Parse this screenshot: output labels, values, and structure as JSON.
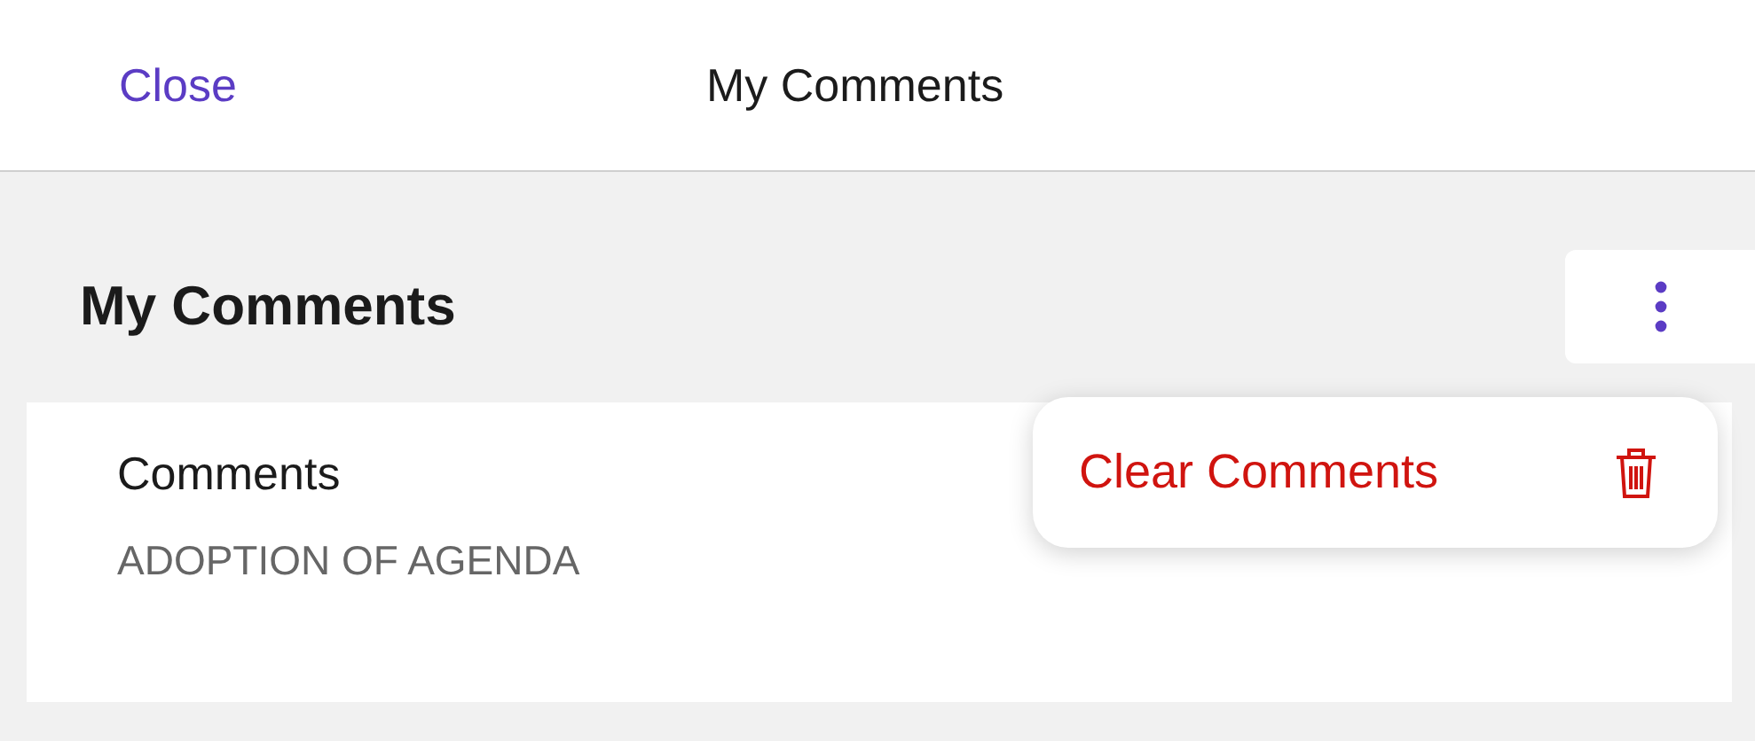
{
  "header": {
    "close_label": "Close",
    "title": "My Comments"
  },
  "section": {
    "heading": "My Comments",
    "menu_expanded": true
  },
  "card": {
    "title": "Comments",
    "subtitle": "ADOPTION OF AGENDA"
  },
  "menu": {
    "items": [
      {
        "label": "Clear Comments",
        "kind": "destructive"
      }
    ]
  }
}
